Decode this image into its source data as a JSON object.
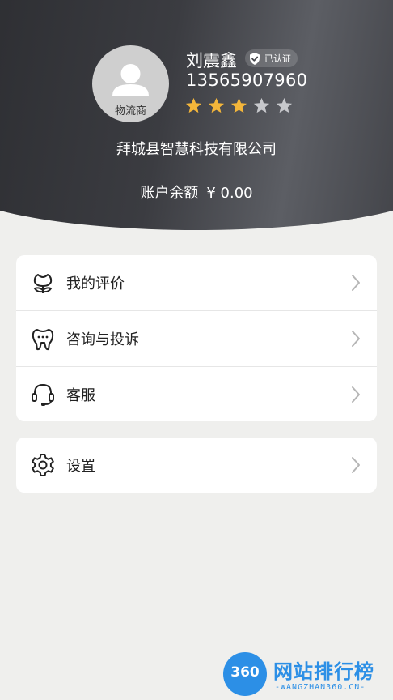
{
  "profile": {
    "role": "物流商",
    "name": "刘震鑫",
    "verified_label": "已认证",
    "phone": "13565907960",
    "rating": {
      "value": 3,
      "max": 5
    },
    "company": "拜城县智慧科技有限公司",
    "balance_label": "账户余额",
    "balance_value": "¥ 0.00"
  },
  "menu": {
    "my_reviews": {
      "label": "我的评价",
      "icon": "flower-icon"
    },
    "consult_complaint": {
      "label": "咨询与投诉",
      "icon": "dental-chat-icon"
    },
    "customer_service": {
      "label": "客服",
      "icon": "headset-icon"
    },
    "settings": {
      "label": "设置",
      "icon": "gear-icon"
    }
  },
  "watermark": {
    "logo_text": "360",
    "title": "网站排行榜",
    "subtitle": "-WANGZHAN360.CN-"
  },
  "colors": {
    "header_dark": "#2a2b2f",
    "star_on": "#f4b63a",
    "star_off": "#c7c8cc",
    "page_bg": "#efefed",
    "watermark_blue": "#2c8fe6"
  }
}
